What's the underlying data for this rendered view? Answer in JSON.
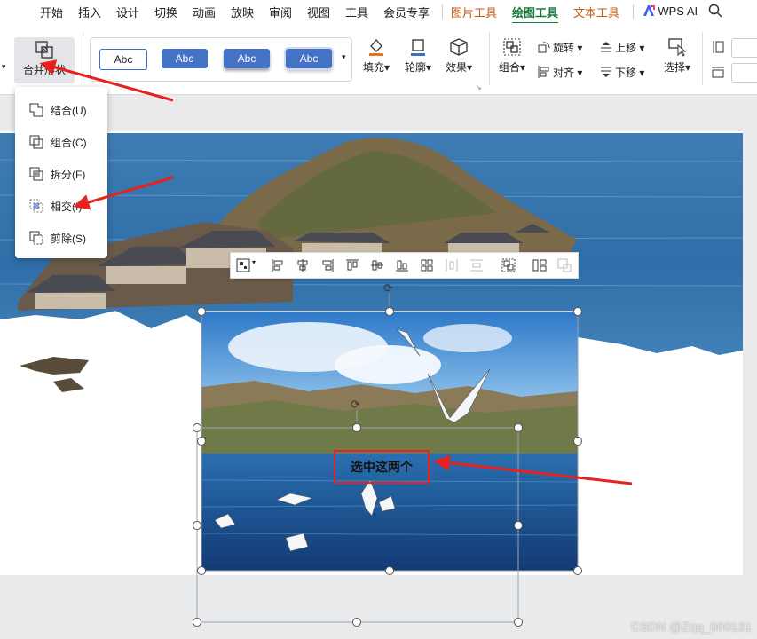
{
  "menubar": {
    "items": [
      "开始",
      "插入",
      "设计",
      "切换",
      "动画",
      "放映",
      "审阅",
      "视图",
      "工具",
      "会员专享"
    ],
    "context_tabs": [
      "图片工具",
      "绘图工具",
      "文本工具"
    ],
    "active_tab": "绘图工具",
    "wps_ai": "WPS AI"
  },
  "ribbon": {
    "merge_shapes": "合并形状",
    "styles": [
      "Abc",
      "Abc",
      "Abc",
      "Abc"
    ],
    "fill": "填充",
    "outline": "轮廓",
    "effects": "效果",
    "group": "组合",
    "rotate": "旋转",
    "align": "对齐",
    "bring_forward": "上移",
    "send_backward": "下移",
    "select": "选择"
  },
  "merge_menu": {
    "items": [
      "结合(U)",
      "组合(C)",
      "拆分(F)",
      "相交(I)",
      "剪除(S)"
    ]
  },
  "callout": {
    "text": "选中这两个"
  },
  "watermark": "CSDN @Zqq_060131",
  "colors": {
    "accent_green": "#1a7a3a",
    "context_orange": "#c55a11",
    "arrow_red": "#e8211f",
    "style_blue": "#4472c4"
  }
}
